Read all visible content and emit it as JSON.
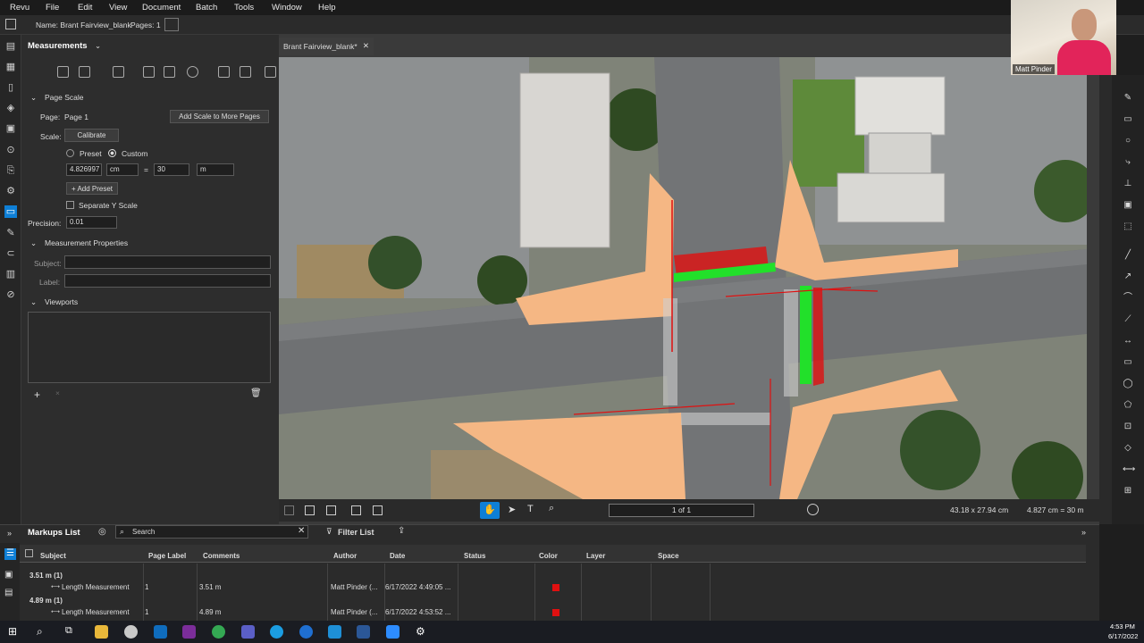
{
  "menu": [
    "Revu",
    "File",
    "Edit",
    "View",
    "Document",
    "Batch",
    "Tools",
    "Window",
    "Help"
  ],
  "docinfo": {
    "name": "Name: Brant Fairview_blank",
    "pages": "Pages: 1"
  },
  "panel": {
    "title": "Measurements",
    "page_scale_header": "Page Scale",
    "page_label": "Page:",
    "page_value": "Page 1",
    "add_scale_button": "Add Scale to More Pages",
    "scale_label": "Scale:",
    "calibrate_button": "Calibrate",
    "preset_label": "Preset",
    "custom_label": "Custom",
    "scale_value": "4.826997",
    "scale_unit": "cm",
    "equals": "=",
    "real_value": "30",
    "real_unit": "m",
    "add_preset_button": "+ Add Preset",
    "separate_y": "Separate Y Scale",
    "precision_label": "Precision:",
    "precision_value": "0.01",
    "measurement_props_header": "Measurement Properties",
    "subject_label": "Subject:",
    "label_label": "Label:",
    "viewports_header": "Viewports"
  },
  "doc_tab": "Brant Fairview_blank*",
  "statusbar": {
    "page": "1 of 1",
    "size": "43.18 x 27.94 cm",
    "scale": "4.827 cm = 30 m"
  },
  "webcam_name": "Matt Pinder",
  "markups": {
    "title": "Markups List",
    "search_placeholder": "Search",
    "filter": "Filter List",
    "columns": [
      "Subject",
      "Page Label",
      "Comments",
      "Author",
      "Date",
      "Status",
      "Color",
      "Layer",
      "Space"
    ],
    "rows": [
      {
        "group": "3.51 m (1)",
        "subject": "Length Measurement",
        "page": "1",
        "comments": "3.51 m",
        "author": "Matt Pinder (...",
        "date": "6/17/2022 4:49:05 ..."
      },
      {
        "group": "4.89 m (1)",
        "subject": "Length Measurement",
        "page": "1",
        "comments": "4.89 m",
        "author": "Matt Pinder (...",
        "date": "6/17/2022 4:53:52 ..."
      }
    ]
  },
  "clock": {
    "time": "4:53 PM",
    "date": "6/17/2022"
  },
  "colors": {
    "accent": "#0e7fd6",
    "markup_red": "#e01010",
    "green": "#22e02a",
    "curb": "#f5b784"
  }
}
